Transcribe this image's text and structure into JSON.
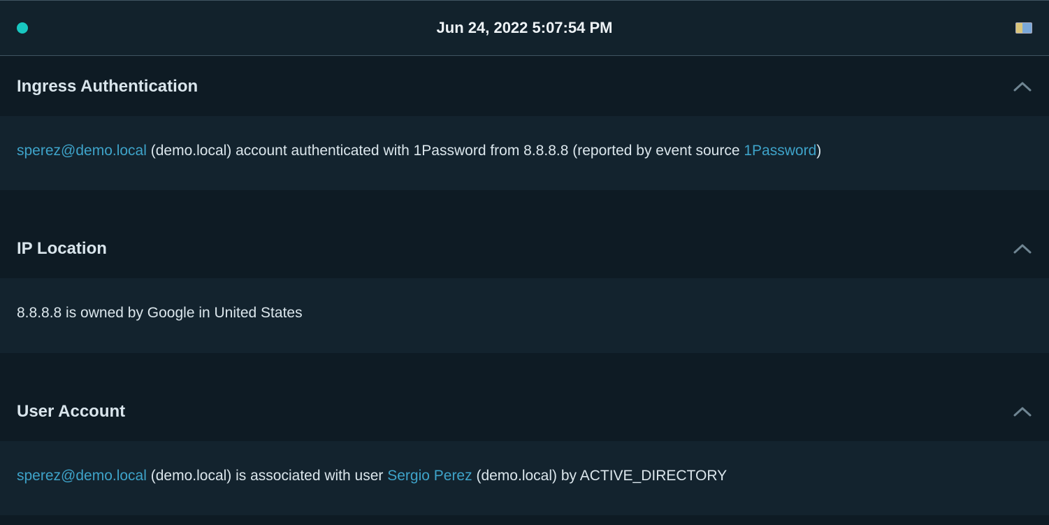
{
  "header": {
    "timestamp": "Jun 24, 2022 5:07:54 PM"
  },
  "sections": {
    "ingress": {
      "title": "Ingress Authentication",
      "account_link": "sperez@demo.local",
      "text_after_account": " (demo.local) account authenticated with 1Password from 8.8.8.8 (reported by event source ",
      "source_link": "1Password",
      "text_tail": ")"
    },
    "iploc": {
      "title": "IP Location",
      "body": "8.8.8.8 is owned by Google in United States"
    },
    "user": {
      "title": "User Account",
      "account_link": "sperez@demo.local",
      "text_mid1": " (demo.local) is associated with user ",
      "user_link": "Sergio Perez",
      "text_mid2": " (demo.local) by ACTIVE_DIRECTORY"
    }
  }
}
